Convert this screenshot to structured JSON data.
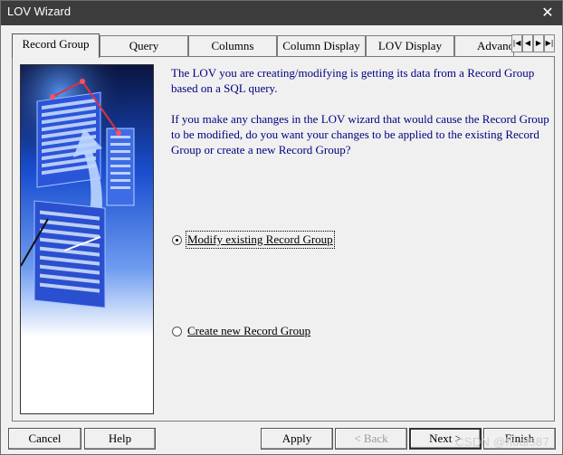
{
  "window": {
    "title": "LOV Wizard"
  },
  "tabs": [
    {
      "label": "Record Group",
      "active": true
    },
    {
      "label": "Query"
    },
    {
      "label": "Columns"
    },
    {
      "label": "Column Display"
    },
    {
      "label": "LOV Display"
    },
    {
      "label": "Advano"
    }
  ],
  "tab_scroll_icons": [
    "first-icon",
    "prev-icon",
    "next-icon",
    "last-icon"
  ],
  "content": {
    "paragraph1": "The LOV you are creating/modifying is getting its data from a Record Group based on a SQL query.",
    "paragraph2": "If you make any changes in the LOV wizard that would cause the Record Group to be modified, do you want your changes to be applied to the existing Record Group or create a new Record Group?",
    "options": [
      {
        "label": "Modify existing Record Group",
        "selected": true
      },
      {
        "label": "Create new Record Group",
        "selected": false
      }
    ]
  },
  "buttons": {
    "cancel": "Cancel",
    "help": "Help",
    "apply": "Apply",
    "back": "< Back",
    "next": "Next >",
    "finish": "Finish"
  },
  "watermark": "CSDN @huai587",
  "colors": {
    "text_blue": "#000080",
    "titlebar": "#3c3c3c",
    "dialog": "#f0f0f0"
  }
}
